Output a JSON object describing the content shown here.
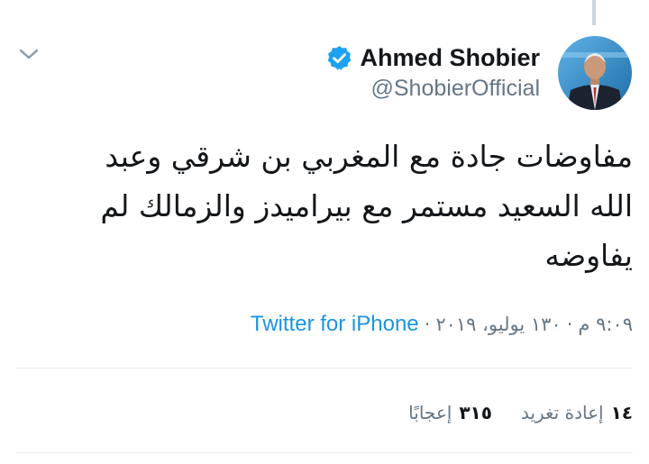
{
  "author": {
    "name": "Ahmed Shobier",
    "handle": "@ShobierOfficial",
    "verified_icon": "verified-badge-icon",
    "avatar_icon": "profile-photo"
  },
  "tweet": {
    "text": "مفاوضات جادة مع المغربي بن شرقي وعبد الله السعيد مستمر مع بيراميدز والزمالك لم يفاوضه",
    "time": "٩:٠٩ م",
    "date": "١٣٠ يوليو، ٢٠١٩",
    "separator": "·",
    "source": "Twitter for iPhone"
  },
  "stats": {
    "retweets_count": "١٤",
    "retweets_label": "إعادة تغريد",
    "likes_count": "٣١٥",
    "likes_label": "إعجابًا"
  },
  "colors": {
    "accent": "#1b95e0",
    "verified": "#1da1f2",
    "secondary_text": "#657786",
    "primary_text": "#14171a",
    "divider": "#e6ecf0"
  },
  "icons": {
    "menu": "chevron-down-icon"
  }
}
